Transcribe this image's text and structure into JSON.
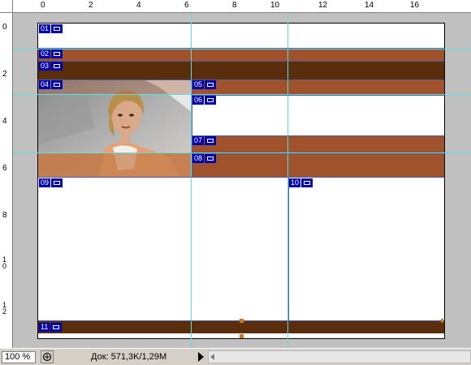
{
  "ruler_h_labels": [
    "0",
    "2",
    "4",
    "6",
    "8",
    "10",
    "12",
    "14",
    "16"
  ],
  "ruler_v_labels": [
    "0",
    "2",
    "4",
    "6",
    "8",
    "1 0",
    "1 2"
  ],
  "slices": [
    {
      "number": "01"
    },
    {
      "number": "02"
    },
    {
      "number": "03"
    },
    {
      "number": "04"
    },
    {
      "number": "05"
    },
    {
      "number": "06"
    },
    {
      "number": "07"
    },
    {
      "number": "08"
    },
    {
      "number": "09"
    },
    {
      "number": "10"
    },
    {
      "number": "11"
    }
  ],
  "colors": {
    "band_medium": "#a0522d",
    "band_dark": "#5a2d0c",
    "guide": "#5ee0e0",
    "slice_tag": "#0000a8"
  },
  "photo": {
    "description_icon": "woman-portrait-image"
  },
  "statusbar": {
    "zoom": "100 %",
    "doc_info": "Док: 571,3K/1,29M"
  }
}
